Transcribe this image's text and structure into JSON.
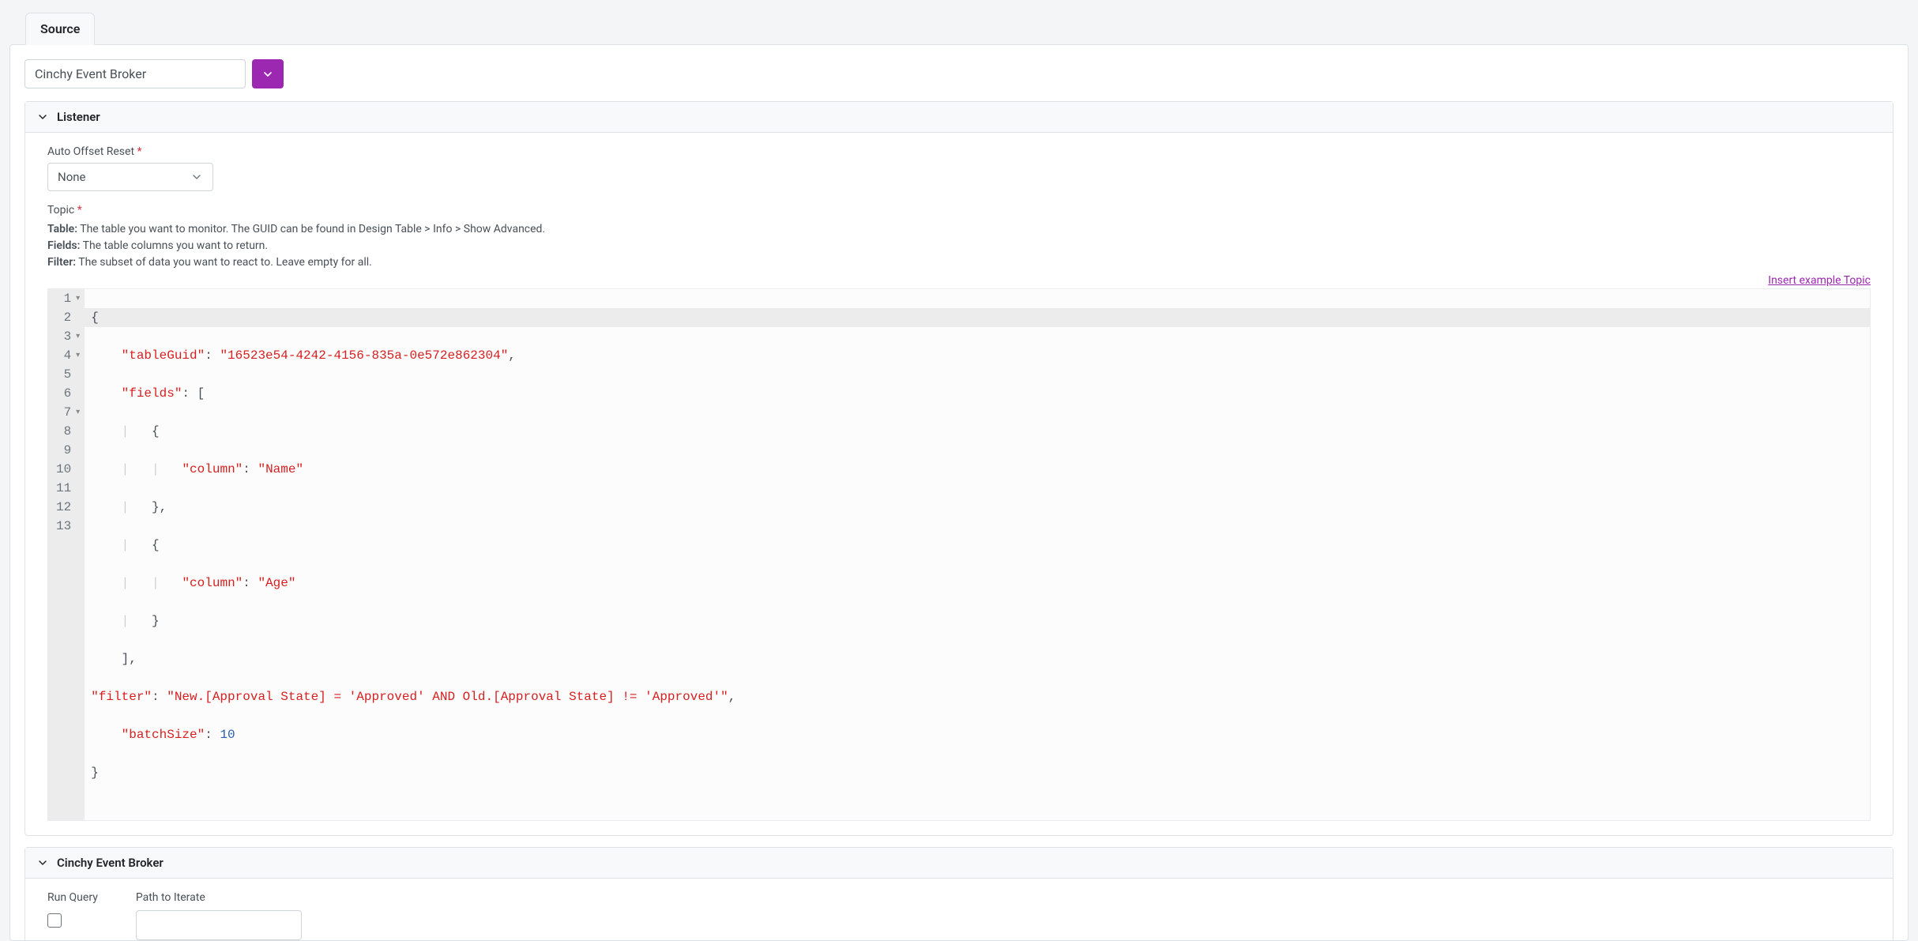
{
  "tab": {
    "label": "Source"
  },
  "source_dropdown": {
    "value": "Cinchy Event Broker"
  },
  "listener": {
    "title": "Listener",
    "auto_offset": {
      "label": "Auto Offset Reset",
      "value": "None"
    },
    "topic": {
      "label": "Topic",
      "help": {
        "table_label": "Table:",
        "table_text": " The table you want to monitor. The GUID can be found in Design Table > Info > Show Advanced.",
        "fields_label": "Fields:",
        "fields_text": " The table columns you want to return.",
        "filter_label": "Filter:",
        "filter_text": " The subset of data you want to react to. Leave empty for all."
      },
      "insert_link": "Insert example Topic"
    },
    "code": {
      "l1": "{",
      "l2_key": "\"tableGuid\"",
      "l2_val": "\"16523e54-4242-4156-835a-0e572e862304\"",
      "l3_key": "\"fields\"",
      "l5_key": "\"column\"",
      "l5_val": "\"Name\"",
      "l8_key": "\"column\"",
      "l8_val": "\"Age\"",
      "l11_key": "\"filter\"",
      "l11_val": "\"New.[Approval State] = 'Approved' AND Old.[Approval State] != 'Approved'\"",
      "l12_key": "\"batchSize\"",
      "l12_val": "10",
      "lnums": [
        "1",
        "2",
        "3",
        "4",
        "5",
        "6",
        "7",
        "8",
        "9",
        "10",
        "11",
        "12",
        "13"
      ]
    }
  },
  "broker": {
    "title": "Cinchy Event Broker",
    "run_query_label": "Run Query",
    "path_label": "Path to Iterate"
  }
}
